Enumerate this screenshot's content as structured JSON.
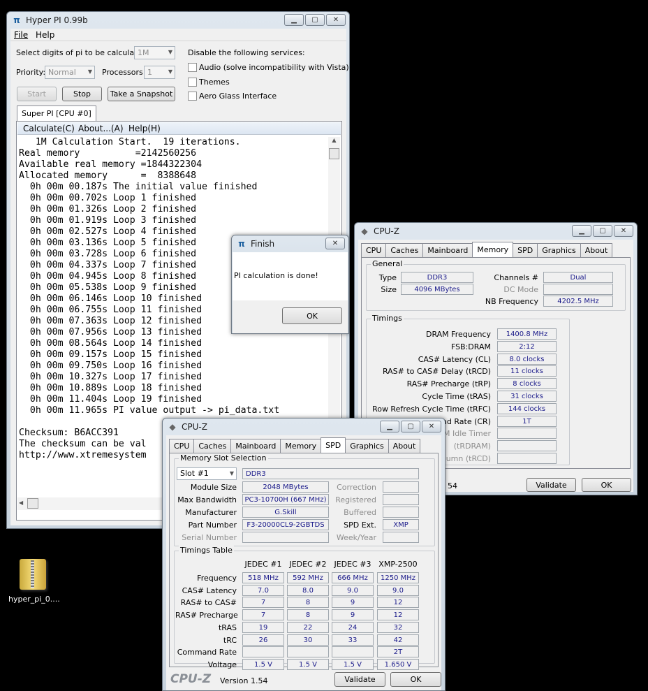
{
  "hyperpi": {
    "title": "Hyper PI 0.99b",
    "menu": [
      "File",
      "Help"
    ],
    "digits_label": "Select digits of pi to be calculated:",
    "digits_value": "1M",
    "priority_label": "Priority:",
    "priority_value": "Normal",
    "processors_label": "Processors:",
    "processors_value": "1",
    "start": "Start",
    "stop": "Stop",
    "snapshot": "Take a Snapshot",
    "disable_label": "Disable the following services:",
    "audio": "Audio (solve incompatibility with Vista)",
    "themes": "Themes",
    "aero": "Aero Glass Interface",
    "tab": "Super PI [CPU #0]",
    "submenu": [
      "Calculate(C)",
      "About...(A)",
      "Help(H)"
    ],
    "output": [
      "   1M Calculation Start.  19 iterations.",
      "Real memory          =2142560256",
      "Available real memory =1844322304",
      "Allocated memory      =  8388648",
      "  0h 00m 00.187s The initial value finished",
      "  0h 00m 00.702s Loop 1 finished",
      "  0h 00m 01.326s Loop 2 finished",
      "  0h 00m 01.919s Loop 3 finished",
      "  0h 00m 02.527s Loop 4 finished",
      "  0h 00m 03.136s Loop 5 finished",
      "  0h 00m 03.728s Loop 6 finished",
      "  0h 00m 04.337s Loop 7 finished",
      "  0h 00m 04.945s Loop 8 finished",
      "  0h 00m 05.538s Loop 9 finished",
      "  0h 00m 06.146s Loop 10 finished",
      "  0h 00m 06.755s Loop 11 finished",
      "  0h 00m 07.363s Loop 12 finished",
      "  0h 00m 07.956s Loop 13 finished",
      "  0h 00m 08.564s Loop 14 finished",
      "  0h 00m 09.157s Loop 15 finished",
      "  0h 00m 09.750s Loop 16 finished",
      "  0h 00m 10.327s Loop 17 finished",
      "  0h 00m 10.889s Loop 18 finished",
      "  0h 00m 11.404s Loop 19 finished",
      "  0h 00m 11.965s PI value output -> pi_data.txt",
      "",
      "Checksum: B6ACC391",
      "The checksum can be val",
      "http://www.xtremesystem"
    ]
  },
  "finish": {
    "title": "Finish",
    "message": "PI calculation is done!",
    "ok": "OK"
  },
  "cpuz_mem": {
    "title": "CPU-Z",
    "tabs": [
      "CPU",
      "Caches",
      "Mainboard",
      "Memory",
      "SPD",
      "Graphics",
      "About"
    ],
    "general": "General",
    "type_label": "Type",
    "type": "DDR3",
    "size_label": "Size",
    "size": "4096 MBytes",
    "channels_label": "Channels #",
    "channels": "Dual",
    "dc_label": "DC Mode",
    "nb_label": "NB Frequency",
    "nb": "4202.5 MHz",
    "timings": "Timings",
    "rows": [
      {
        "label": "DRAM Frequency",
        "value": "1400.8 MHz"
      },
      {
        "label": "FSB:DRAM",
        "value": "2:12"
      },
      {
        "label": "CAS# Latency (CL)",
        "value": "8.0 clocks"
      },
      {
        "label": "RAS# to CAS# Delay (tRCD)",
        "value": "11 clocks"
      },
      {
        "label": "RAS# Precharge (tRP)",
        "value": "8 clocks"
      },
      {
        "label": "Cycle Time (tRAS)",
        "value": "31 clocks"
      },
      {
        "label": "Row Refresh Cycle Time (tRFC)",
        "value": "144 clocks"
      },
      {
        "label": "Command Rate (CR)",
        "value": "1T"
      },
      {
        "label": "M Idle Timer",
        "value": ""
      },
      {
        "label": "(tRDRAM)",
        "value": ""
      },
      {
        "label": "umn (tRCD)",
        "value": ""
      }
    ],
    "version": "54",
    "validate": "Validate",
    "ok": "OK"
  },
  "cpuz_spd": {
    "title": "CPU-Z",
    "tabs": [
      "CPU",
      "Caches",
      "Mainboard",
      "Memory",
      "SPD",
      "Graphics",
      "About"
    ],
    "slot_group": "Memory Slot Selection",
    "slot": "Slot #1",
    "slot_type": "DDR3",
    "left": [
      {
        "label": "Module Size",
        "value": "2048 MBytes"
      },
      {
        "label": "Max Bandwidth",
        "value": "PC3-10700H (667 MHz)"
      },
      {
        "label": "Manufacturer",
        "value": "G.Skill"
      },
      {
        "label": "Part Number",
        "value": "F3-20000CL9-2GBTDS"
      },
      {
        "label": "Serial Number",
        "value": ""
      }
    ],
    "right": [
      {
        "label": "Correction",
        "value": ""
      },
      {
        "label": "Registered",
        "value": ""
      },
      {
        "label": "Buffered",
        "value": ""
      },
      {
        "label": "SPD Ext.",
        "value": "XMP"
      },
      {
        "label": "Week/Year",
        "value": ""
      }
    ],
    "timings_group": "Timings Table",
    "cols": [
      "JEDEC #1",
      "JEDEC #2",
      "JEDEC #3",
      "XMP-2500"
    ],
    "trows": [
      {
        "label": "Frequency",
        "v": [
          "518 MHz",
          "592 MHz",
          "666 MHz",
          "1250 MHz"
        ]
      },
      {
        "label": "CAS# Latency",
        "v": [
          "7.0",
          "8.0",
          "9.0",
          "9.0"
        ]
      },
      {
        "label": "RAS# to CAS#",
        "v": [
          "7",
          "8",
          "9",
          "12"
        ]
      },
      {
        "label": "RAS# Precharge",
        "v": [
          "7",
          "8",
          "9",
          "12"
        ]
      },
      {
        "label": "tRAS",
        "v": [
          "19",
          "22",
          "24",
          "32"
        ]
      },
      {
        "label": "tRC",
        "v": [
          "26",
          "30",
          "33",
          "42"
        ]
      },
      {
        "label": "Command Rate",
        "v": [
          "",
          "",
          "",
          "2T"
        ]
      },
      {
        "label": "Voltage",
        "v": [
          "1.5 V",
          "1.5 V",
          "1.5 V",
          "1.650 V"
        ]
      }
    ],
    "brand": "CPU-Z",
    "version": "Version 1.54",
    "validate": "Validate",
    "ok": "OK"
  },
  "desktop": {
    "icon_label": "hyper_pi_0...."
  }
}
